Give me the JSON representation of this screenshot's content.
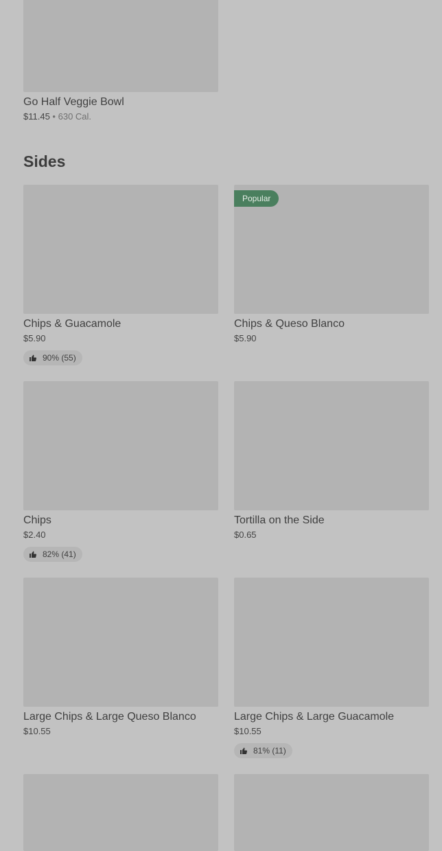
{
  "top_item": {
    "name": "Go Half Veggie Bowl",
    "price": "$11.45",
    "separator": "•",
    "calories": "630 Cal."
  },
  "section_title": "Sides",
  "items": [
    {
      "name": "Chips & Guacamole",
      "price": "$5.90",
      "rating": "90% (55)",
      "badge": ""
    },
    {
      "name": "Chips & Queso Blanco",
      "price": "$5.90",
      "rating": "",
      "badge": "Popular"
    },
    {
      "name": "Chips",
      "price": "$2.40",
      "rating": "82% (41)",
      "badge": ""
    },
    {
      "name": "Tortilla on the Side",
      "price": "$0.65",
      "rating": "",
      "badge": ""
    },
    {
      "name": "Large Chips & Large Queso Blanco",
      "price": "$10.55",
      "rating": "",
      "badge": ""
    },
    {
      "name": "Large Chips & Large Guacamole",
      "price": "$10.55",
      "rating": "81% (11)",
      "badge": ""
    }
  ],
  "icons": {
    "rating": "thumbs-up-icon"
  },
  "colors": {
    "background": "#c2c2c2",
    "image_placeholder": "#b3b3b3",
    "popular_badge": "#4a7f5e"
  }
}
